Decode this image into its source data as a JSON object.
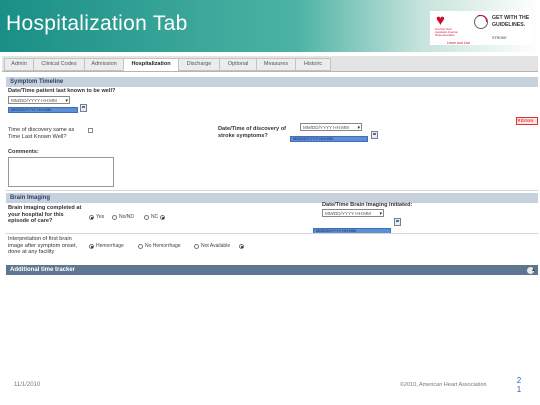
{
  "slide": {
    "title": "Hospitalization Tab",
    "date": "11/1/2010",
    "copyright": "©2010, American Heart Association",
    "page_digit_1": "2",
    "page_digit_2": "1"
  },
  "logos": {
    "aha_text": "American Heart Association American Stroke Association",
    "aha_sub": "Learn and Live",
    "gwtg_text": "GET WITH THE GUIDELINES.",
    "gwtg_sub": "STROKE"
  },
  "tabs": [
    {
      "label": "Admin"
    },
    {
      "label": "Clinical Codes"
    },
    {
      "label": "Admission"
    },
    {
      "label": "Hospitalization"
    },
    {
      "label": "Discharge"
    },
    {
      "label": "Optional"
    },
    {
      "label": "Measures"
    },
    {
      "label": "Historic"
    }
  ],
  "active_tab": "Hospitalization",
  "symptom_timeline": {
    "header": "Symptom Timeline",
    "last_known_well_label": "Date/Time patient last known to be well?",
    "last_known_well_select": "MM/DD/YYYY HH:MM",
    "discovery_same_label": "Time of discovery same as Time Last Known Well?",
    "discovery_label": "Date/Time of discovery of stroke symptoms?",
    "discovery_select": "MM/DD/YYYY HH:MM",
    "comments_label": "Comments:",
    "error_text": "Errors"
  },
  "brain_imaging": {
    "header": "Brain Imaging",
    "completed_label": "Brain imaging completed at your hospital for this episode of care?",
    "completed_options": [
      "Yes",
      "No/ND",
      "NC"
    ],
    "initiated_label": "Date/Time Brain Imaging Initiated:",
    "initiated_select": "MM/DD/YYYY HH:MM",
    "interpretation_label": "Interpretation of first brain image after symptom onset, done at any facility",
    "interpretation_options": [
      "Hemorrhage",
      "No Hemorrhage",
      "Not Available"
    ]
  },
  "additional_tracker": {
    "header": "Additional time tracker"
  },
  "colors": {
    "banner": "#1a8f86",
    "section_header": "#c7d1de",
    "section_header_dark": "#5e7791",
    "highlight_box": "#5b8fd6"
  }
}
